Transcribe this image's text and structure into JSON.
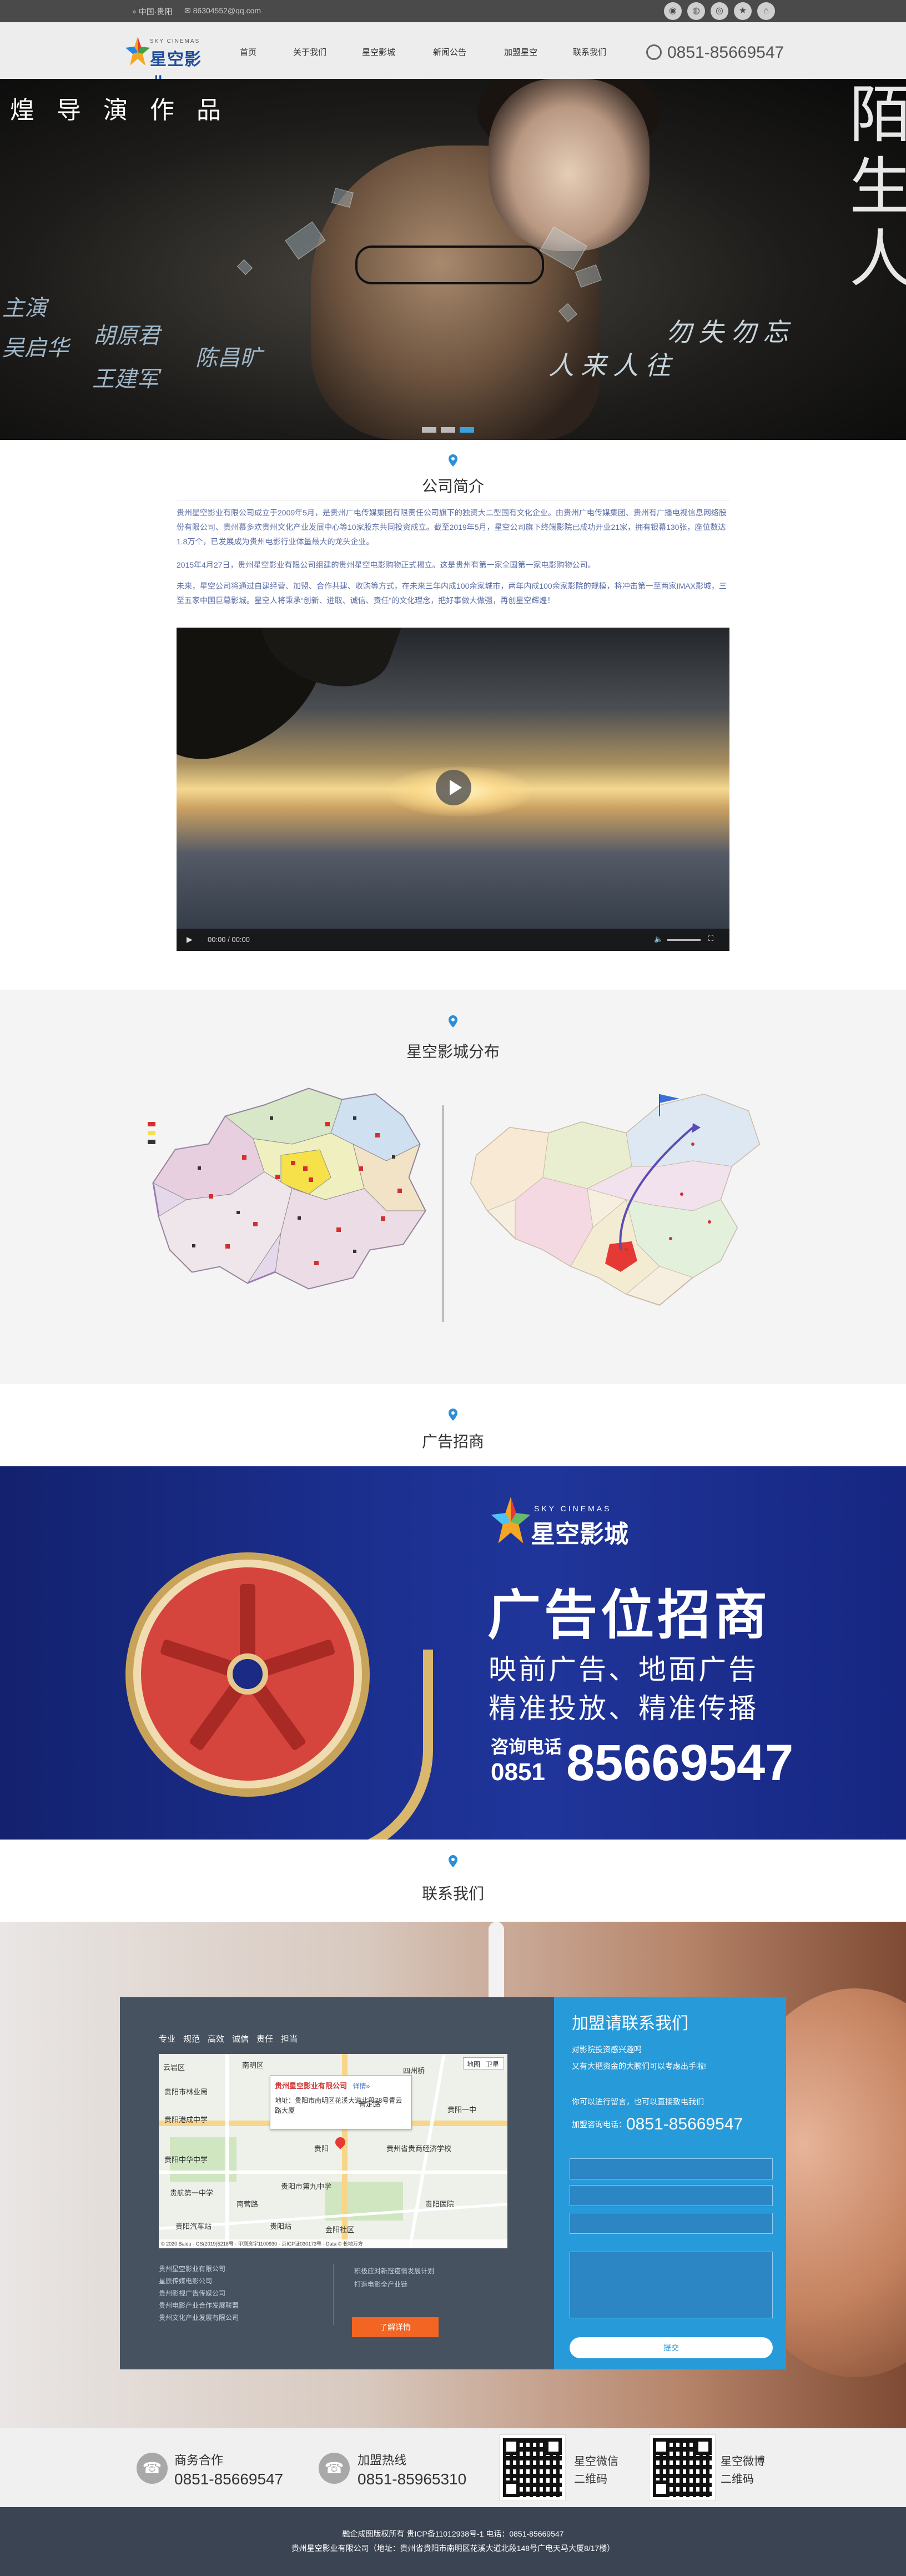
{
  "topbar": {
    "location": "中国·贵阳",
    "email": "86304552@qq.com",
    "social_icons": [
      "weibo-icon",
      "wechat-icon",
      "qq-icon",
      "star-icon",
      "home-icon"
    ]
  },
  "nav": {
    "logo_en": "SKY CINEMAS",
    "logo_zh": "星空影业",
    "items": [
      "首页",
      "关于我们",
      "星空影城",
      "新闻公告",
      "加盟星空",
      "联系我们"
    ],
    "phone": "0851-85669547"
  },
  "banner": {
    "title": "煌导演作品",
    "cast_label": "主演",
    "cast": [
      "吴启华",
      "胡原君",
      "王建军",
      "陈昌旷"
    ],
    "slogan": [
      "人来人往",
      "勿失勿忘"
    ],
    "movie": "陌生人"
  },
  "intro": {
    "title": "公司简介",
    "p1": "贵州星空影业有限公司成立于2009年5月，是贵州广电传媒集团有限责任公司旗下的独资大二型国有文化企业。由贵州广电传媒集团、贵州有广播电视信息网络股份有限公司、贵州慕多欢贵州文化产业发展中心等10家股东共同投资成立。截至2019年5月，星空公司旗下终端影院已成功开业21家，拥有银幕130张，座位数达1.8万个，已发展成为贵州电影行业体量最大的龙头企业。",
    "p2": "2015年4月27日，贵州星空影业有限公司组建的贵州星空电影购物正式揭立。这是贵州有第一家全国第一家电影购物公司。",
    "p3": "未来，星空公司将通过自建经营、加盟、合作共建、收购等方式，在未来三年内成100余家城市，两年内成100余家影院的规模，将冲击第一至两家IMAX影城，三至五家中国巨幕影城。星空人将秉承“创新、进取、诚信、责任”的文化理念，把好事做大做强，再创星空辉煌！",
    "video_time": "00:00 / 00:00"
  },
  "distribution": {
    "title": "星空影城分布"
  },
  "ad_section": {
    "title": "广告招商",
    "logo_en": "SKY CINEMAS",
    "logo_zh": "星空影城",
    "headline": "广告位招商",
    "line1": "映前广告、地面广告",
    "line2": "精准投放、精准传播",
    "tel_label": "咨询电话",
    "tel_area": "0851",
    "tel_number": "85669547"
  },
  "contact": {
    "title": "联系我们",
    "categories": [
      "专业",
      "规范",
      "高效",
      "诚信",
      "责任",
      "担当"
    ],
    "map": {
      "company": "贵州星空影业有限公司",
      "detail_link": "详情»",
      "address": "地址：贵阳市南明区花溪大道北段78号青云路大厦",
      "labels": [
        "云岩区",
        "南明区",
        "贵阳市林业局",
        "贵州省贵商经济学校",
        "贵阳市第九中学",
        "贵阳港成中学",
        "贵阳中华中学",
        "贵航第一中学",
        "贵阳医院",
        "贵阳汽车站",
        "贵阳一中",
        "南营路",
        "普定路",
        "贵阳",
        "四州桥",
        "金阳社区",
        "贵阳站"
      ],
      "map_controls": [
        "地图",
        "卫星"
      ],
      "copyright": "© 2020 Baidu - GS(2019)5218号 - 甲测资字1100930 - 京ICP证030173号 - Data © 长地万方"
    },
    "links_left": [
      "贵州星空影业有限公司",
      "星辰传媒电影公司",
      "贵州影视广告传媒公司",
      "贵州电影产业合作发展联盟",
      "贵州文化产业发展有限公司"
    ],
    "links_right": [
      "积极应对新冠疫情发展计划",
      "打造电影全产业链"
    ],
    "more_button": "了解详情",
    "right_title": "加盟请联系我们",
    "right_p1": "对影院投资感兴趣吗",
    "right_p2": "又有大把资金的大腕们可以考虑出手啦!",
    "right_p3": "你可以进行留言，也可以直接致电我们",
    "right_phone_label": "加盟咨询电话：",
    "right_phone": "0851-85669547",
    "submit": "提交"
  },
  "strip": {
    "biz_label": "商务合作",
    "biz_phone": "0851-85669547",
    "join_label": "加盟热线",
    "join_phone": "0851-85965310",
    "qr1_line1": "星空微信",
    "qr1_line2": "二维码",
    "qr2_line1": "星空微博",
    "qr2_line2": "二维码"
  },
  "footer": {
    "line1": "融企成图版权所有 贵ICP备11012938号-1 电话：0851-85669547",
    "line2": "贵州星空影业有限公司（地址：贵州省贵阳市南明区花溪大道北段148号广电天马大厦8/17楼）"
  },
  "colors": {
    "accent_blue": "#279ad9",
    "ad_blue": "#1b2f8f",
    "orange": "#f26522",
    "footer": "#3b4453"
  }
}
